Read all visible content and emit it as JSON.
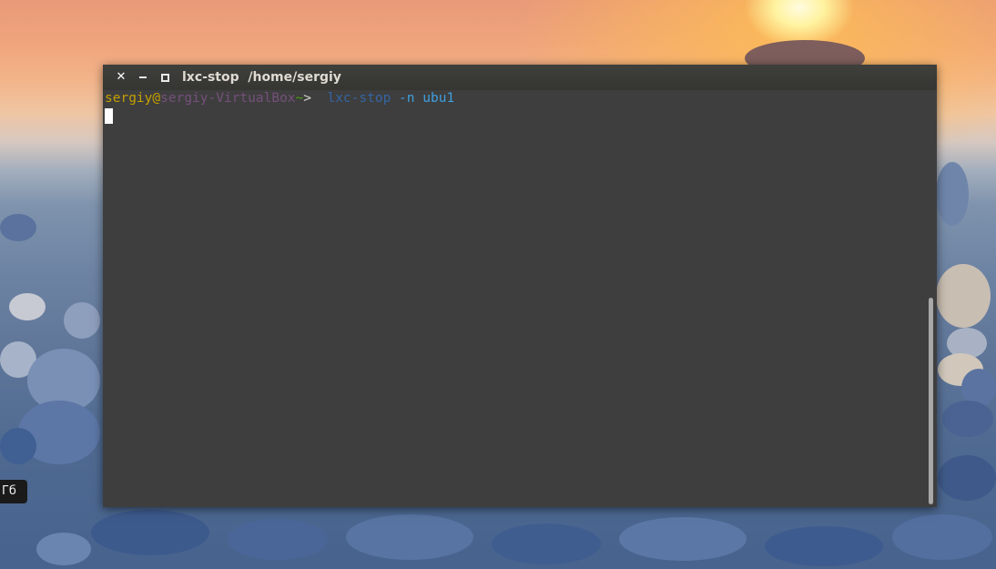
{
  "window": {
    "title_command": "lxc-stop",
    "title_path": "/home/sergiy",
    "close_glyph": "✕"
  },
  "prompt": {
    "user": "sergiy",
    "at": "@",
    "host": "sergiy-VirtualBox",
    "tilde": "~",
    "arrow": ">",
    "command": "lxc-stop",
    "flag": "-n",
    "argument": "ubu1"
  },
  "desktop": {
    "side_label": "Гб"
  },
  "colors": {
    "terminal_bg": "#3e3e3e",
    "user": "#c4a000",
    "host": "#75507b",
    "tilde": "#4e9a06",
    "command": "#3465a4",
    "args": "#3f9fdf"
  },
  "icons": {
    "close": "close-icon",
    "minimize": "minimize-icon",
    "maximize": "maximize-icon"
  }
}
